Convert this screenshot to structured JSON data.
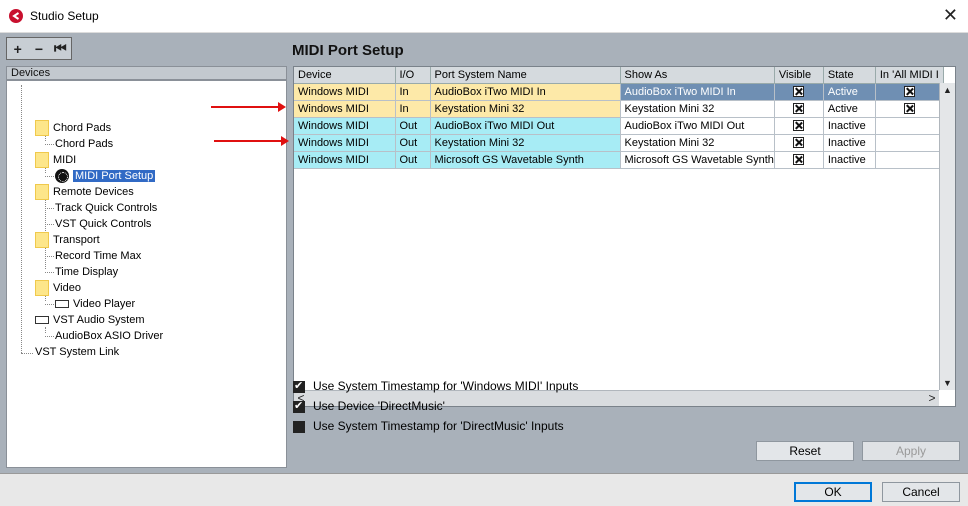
{
  "window": {
    "title": "Studio Setup",
    "close_glyph": "✕"
  },
  "toolbar": {
    "add": "+",
    "remove": "−",
    "reset": "⏮"
  },
  "devices_header": "Devices",
  "tree": {
    "chord_pads_folder": "Chord Pads",
    "chord_pads": "Chord Pads",
    "midi_folder": "MIDI",
    "midi_port_setup": "MIDI Port Setup",
    "remote_devices": "Remote Devices",
    "track_quick_controls": "Track Quick Controls",
    "vst_quick_controls": "VST Quick Controls",
    "transport": "Transport",
    "record_time_max": "Record Time Max",
    "time_display": "Time Display",
    "video": "Video",
    "video_player": "Video Player",
    "vst_audio_system": "VST Audio System",
    "audiobox_asio": "AudioBox ASIO Driver",
    "vst_system_link": "VST System Link"
  },
  "panel": {
    "title": "MIDI Port Setup"
  },
  "columns": [
    "Device",
    "I/O",
    "Port System Name",
    "Show As",
    "Visible",
    "State",
    "In 'All MIDI I"
  ],
  "rows": [
    {
      "device": "Windows MIDI",
      "io": "In",
      "port": "AudioBox iTwo MIDI In",
      "show_as": "AudioBox iTwo MIDI In",
      "visible": true,
      "state": "Active",
      "in_all": true
    },
    {
      "device": "Windows MIDI",
      "io": "In",
      "port": "Keystation Mini 32",
      "show_as": "Keystation Mini 32",
      "visible": true,
      "state": "Active",
      "in_all": true
    },
    {
      "device": "Windows MIDI",
      "io": "Out",
      "port": "AudioBox iTwo MIDI Out",
      "show_as": "AudioBox iTwo MIDI Out",
      "visible": true,
      "state": "Inactive",
      "in_all": false
    },
    {
      "device": "Windows MIDI",
      "io": "Out",
      "port": "Keystation Mini 32",
      "show_as": "Keystation Mini 32",
      "visible": true,
      "state": "Inactive",
      "in_all": false
    },
    {
      "device": "Windows MIDI",
      "io": "Out",
      "port": "Microsoft GS Wavetable Synth",
      "show_as": "Microsoft GS Wavetable Synth",
      "visible": true,
      "state": "Inactive",
      "in_all": false
    }
  ],
  "options": [
    {
      "label": "Use System Timestamp for 'Windows MIDI' Inputs",
      "checked": true
    },
    {
      "label": "Use Device 'DirectMusic'",
      "checked": true
    },
    {
      "label": "Use System Timestamp for 'DirectMusic' Inputs",
      "checked": false
    }
  ],
  "buttons": {
    "reset": "Reset",
    "apply": "Apply",
    "ok": "OK",
    "cancel": "Cancel"
  },
  "scroll": {
    "up": "▲",
    "down": "▼",
    "left": "<",
    "right": ">"
  },
  "colors": {
    "in_row": "#fde9a8",
    "out_row": "#a7ecf5",
    "selected_row": "#6f8fb3",
    "annotation_arrow": "#e01010"
  }
}
